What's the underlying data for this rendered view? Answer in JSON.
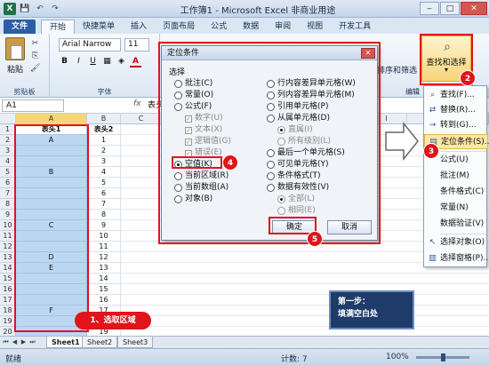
{
  "window": {
    "title": "工作簿1 - Microsoft Excel 非商业用途",
    "app_icon": "X",
    "min": "‒",
    "max": "□",
    "close": "✕"
  },
  "tabs": [
    "文件",
    "开始",
    "快捷菜单",
    "插入",
    "页面布局",
    "公式",
    "数据",
    "审阅",
    "视图",
    "开发工具"
  ],
  "ribbon": {
    "paste_label": "粘贴",
    "clipboard_label": "剪贴板",
    "font_name": "Arial Narrow",
    "font_size": "11",
    "font_group_label": "字体",
    "sort_filter_label": "排序和筛选",
    "find_select_label": "查找和选择",
    "find_select_arrow": "▾",
    "edit_group_label": "编辑"
  },
  "formula_bar": {
    "name_box": "A1",
    "fx": "fx",
    "content": "表头"
  },
  "grid": {
    "columns": [
      "A",
      "B",
      "C",
      "D",
      "E",
      "F",
      "G",
      "H",
      "I",
      "J",
      "K"
    ],
    "header_a": "表头1",
    "header_b": "表头2",
    "rows": [
      {
        "n": "1",
        "a": "表头1",
        "b": "表头2"
      },
      {
        "n": "2",
        "a": "A",
        "b": "1"
      },
      {
        "n": "3",
        "a": "",
        "b": "2"
      },
      {
        "n": "4",
        "a": "",
        "b": "3"
      },
      {
        "n": "5",
        "a": "B",
        "b": "4"
      },
      {
        "n": "6",
        "a": "",
        "b": "5"
      },
      {
        "n": "7",
        "a": "",
        "b": "6"
      },
      {
        "n": "8",
        "a": "",
        "b": "7"
      },
      {
        "n": "9",
        "a": "",
        "b": "8"
      },
      {
        "n": "10",
        "a": "C",
        "b": "9"
      },
      {
        "n": "11",
        "a": "",
        "b": "10"
      },
      {
        "n": "12",
        "a": "",
        "b": "11"
      },
      {
        "n": "13",
        "a": "D",
        "b": "12"
      },
      {
        "n": "14",
        "a": "E",
        "b": "13"
      },
      {
        "n": "15",
        "a": "",
        "b": "14"
      },
      {
        "n": "16",
        "a": "",
        "b": "15"
      },
      {
        "n": "17",
        "a": "",
        "b": "16"
      },
      {
        "n": "18",
        "a": "F",
        "b": "17"
      },
      {
        "n": "19",
        "a": "",
        "b": "18"
      },
      {
        "n": "20",
        "a": "",
        "b": "19"
      }
    ]
  },
  "sheets": [
    "Sheet1",
    "Sheet2",
    "Sheet3"
  ],
  "status": {
    "ready": "就绪",
    "count": "计数: 7",
    "zoom": "100%"
  },
  "dialog": {
    "title": "定位条件",
    "group": "选择",
    "left": [
      "批注(C)",
      "常量(O)",
      "公式(F)",
      "数字(U)",
      "文本(X)",
      "逻辑值(G)",
      "错误(E)",
      "空值(K)",
      "当前区域(R)",
      "当前数组(A)",
      "对象(B)"
    ],
    "right": [
      "行内容差异单元格(W)",
      "列内容差异单元格(M)",
      "引用单元格(P)",
      "从属单元格(D)",
      "直属(I)",
      "所有级别(L)",
      "最后一个单元格(S)",
      "可见单元格(Y)",
      "条件格式(T)",
      "数据有效性(V)",
      "全部(L)",
      "相同(E)"
    ],
    "ok": "确定",
    "cancel": "取消"
  },
  "menu": {
    "items": [
      "查找(F)...",
      "替换(R)...",
      "转到(G)...",
      "定位条件(S)...",
      "公式(U)",
      "批注(M)",
      "条件格式(C)",
      "常量(N)",
      "数据验证(V)",
      "选择对象(O)",
      "选择窗格(P)..."
    ]
  },
  "annotations": {
    "step1": "1、选取区域",
    "b2": "2",
    "b3": "3",
    "b4": "4",
    "b5": "5",
    "note_line1": "第一步：",
    "note_line2": "填满空白处"
  },
  "colors": {
    "accent": "#e0141b",
    "selection": "#bcd7f1",
    "ribbon": "#dde8f4"
  }
}
